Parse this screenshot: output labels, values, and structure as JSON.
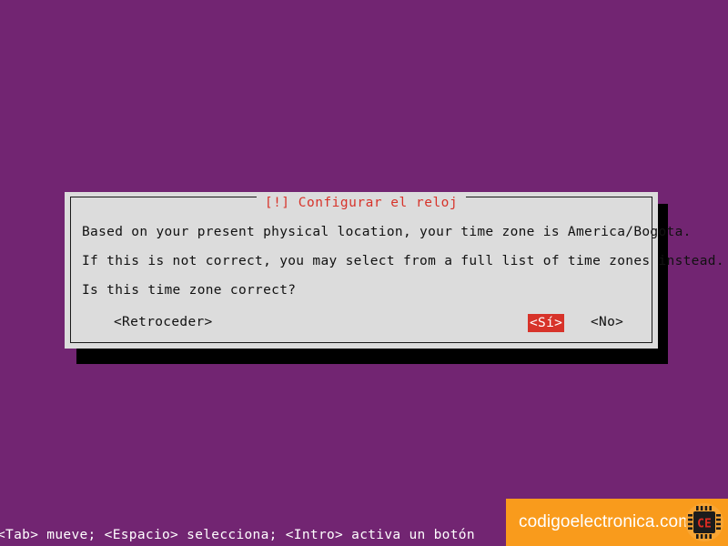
{
  "screen": {
    "background_color": "#722572"
  },
  "dialog": {
    "title": "[!] Configurar el reloj",
    "title_color": "#d7332a",
    "background_color": "#dcdcdc",
    "border_color": "#1a1a1a",
    "lines": [
      "Based on your present physical location, your time zone is America/Bogota.",
      "If this is not correct, you may select from a full list of time zones instead.",
      "Is this time zone correct?"
    ],
    "buttons": {
      "back": "<Retroceder>",
      "yes": "<Sí>",
      "no": "<No>",
      "selected": "<Sí>",
      "selected_bg_color": "#d7332a",
      "selected_fg_color": "#ffffff"
    }
  },
  "help_bar": {
    "text": "<Tab> mueve; <Espacio> selecciona; <Intro> activa un botón",
    "text_color": "#ffffff"
  },
  "watermark": {
    "text": "codigoelectronica.com",
    "background_color": "#f99b1c",
    "text_color": "#ffffff",
    "logo_label": "CE",
    "logo_icon": "microchip-icon"
  }
}
